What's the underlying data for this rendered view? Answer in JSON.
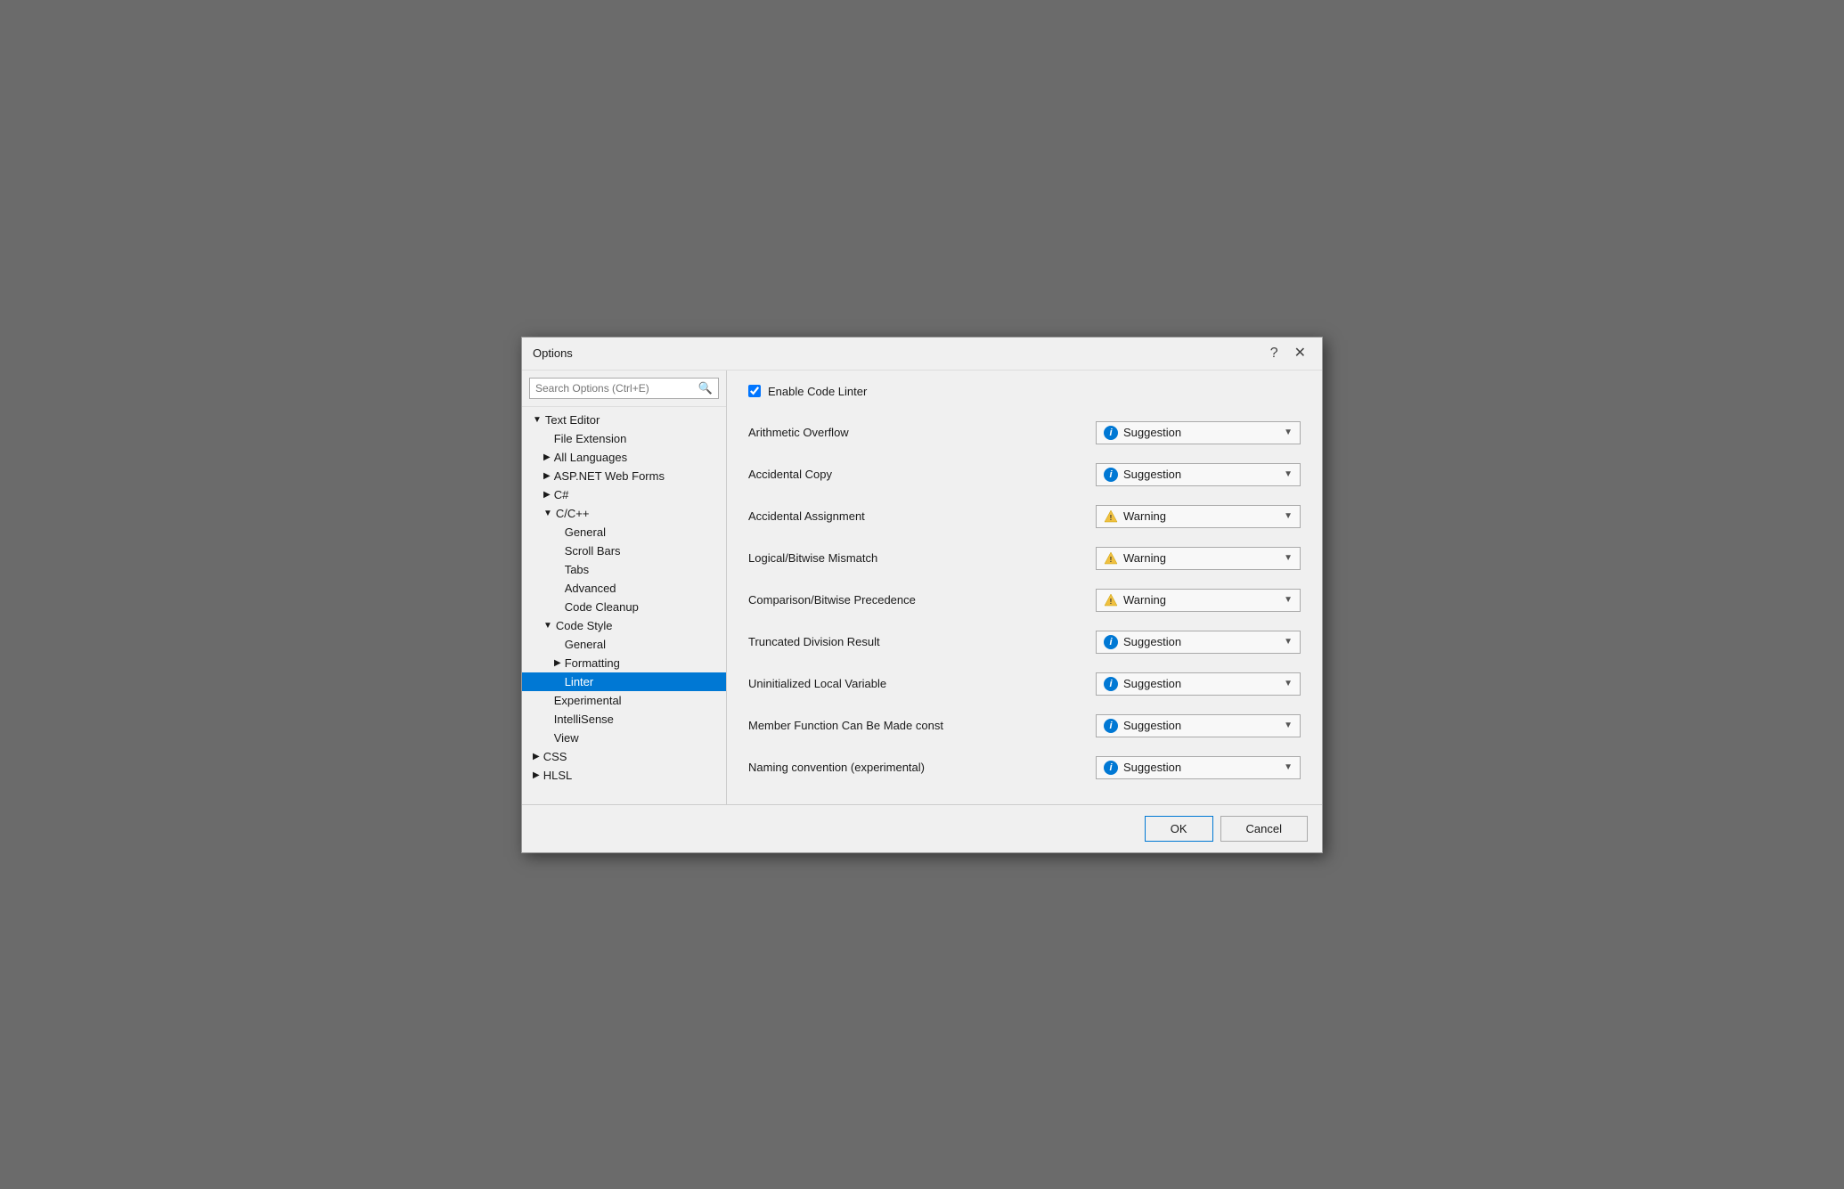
{
  "window": {
    "title": "Options",
    "help_button": "?",
    "close_button": "✕"
  },
  "search": {
    "placeholder": "Search Options (Ctrl+E)"
  },
  "tree": {
    "items": [
      {
        "id": "text-editor",
        "label": "Text Editor",
        "level": 0,
        "arrow": "▼",
        "selected": false
      },
      {
        "id": "file-extension",
        "label": "File Extension",
        "level": 1,
        "arrow": "",
        "selected": false
      },
      {
        "id": "all-languages",
        "label": "All Languages",
        "level": 1,
        "arrow": "▶",
        "selected": false
      },
      {
        "id": "aspnet",
        "label": "ASP.NET Web Forms",
        "level": 1,
        "arrow": "▶",
        "selected": false
      },
      {
        "id": "csharp",
        "label": "C#",
        "level": 1,
        "arrow": "▶",
        "selected": false
      },
      {
        "id": "cpp",
        "label": "C/C++",
        "level": 1,
        "arrow": "▼",
        "selected": false
      },
      {
        "id": "cpp-general",
        "label": "General",
        "level": 2,
        "arrow": "",
        "selected": false
      },
      {
        "id": "cpp-scrollbars",
        "label": "Scroll Bars",
        "level": 2,
        "arrow": "",
        "selected": false
      },
      {
        "id": "cpp-tabs",
        "label": "Tabs",
        "level": 2,
        "arrow": "",
        "selected": false
      },
      {
        "id": "cpp-advanced",
        "label": "Advanced",
        "level": 2,
        "arrow": "",
        "selected": false
      },
      {
        "id": "cpp-codecleanup",
        "label": "Code Cleanup",
        "level": 2,
        "arrow": "",
        "selected": false
      },
      {
        "id": "code-style",
        "label": "Code Style",
        "level": 1,
        "arrow": "▼",
        "selected": false
      },
      {
        "id": "cs-general",
        "label": "General",
        "level": 2,
        "arrow": "",
        "selected": false
      },
      {
        "id": "cs-formatting",
        "label": "Formatting",
        "level": 2,
        "arrow": "▶",
        "selected": false
      },
      {
        "id": "linter",
        "label": "Linter",
        "level": 2,
        "arrow": "",
        "selected": true
      },
      {
        "id": "experimental",
        "label": "Experimental",
        "level": 1,
        "arrow": "",
        "selected": false
      },
      {
        "id": "intellisense",
        "label": "IntelliSense",
        "level": 1,
        "arrow": "",
        "selected": false
      },
      {
        "id": "view",
        "label": "View",
        "level": 1,
        "arrow": "",
        "selected": false
      },
      {
        "id": "css",
        "label": "CSS",
        "level": 0,
        "arrow": "▶",
        "selected": false
      },
      {
        "id": "hlsl",
        "label": "HLSL",
        "level": 0,
        "arrow": "▶",
        "selected": false
      }
    ]
  },
  "main": {
    "enable_linter_label": "Enable Code Linter",
    "enable_linter_checked": true,
    "options": [
      {
        "id": "arithmetic-overflow",
        "label": "Arithmetic Overflow",
        "type": "suggestion",
        "value": "Suggestion"
      },
      {
        "id": "accidental-copy",
        "label": "Accidental Copy",
        "type": "suggestion",
        "value": "Suggestion"
      },
      {
        "id": "accidental-assignment",
        "label": "Accidental Assignment",
        "type": "warning",
        "value": "Warning"
      },
      {
        "id": "logical-bitwise-mismatch",
        "label": "Logical/Bitwise Mismatch",
        "type": "warning",
        "value": "Warning"
      },
      {
        "id": "comparison-bitwise-precedence",
        "label": "Comparison/Bitwise Precedence",
        "type": "warning",
        "value": "Warning"
      },
      {
        "id": "truncated-division-result",
        "label": "Truncated Division Result",
        "type": "suggestion",
        "value": "Suggestion"
      },
      {
        "id": "uninitialized-local-variable",
        "label": "Uninitialized Local Variable",
        "type": "suggestion",
        "value": "Suggestion"
      },
      {
        "id": "member-function-const",
        "label": "Member Function Can Be Made const",
        "type": "suggestion",
        "value": "Suggestion"
      },
      {
        "id": "naming-convention",
        "label": "Naming convention (experimental)",
        "type": "suggestion",
        "value": "Suggestion"
      }
    ]
  },
  "footer": {
    "ok_label": "OK",
    "cancel_label": "Cancel"
  }
}
